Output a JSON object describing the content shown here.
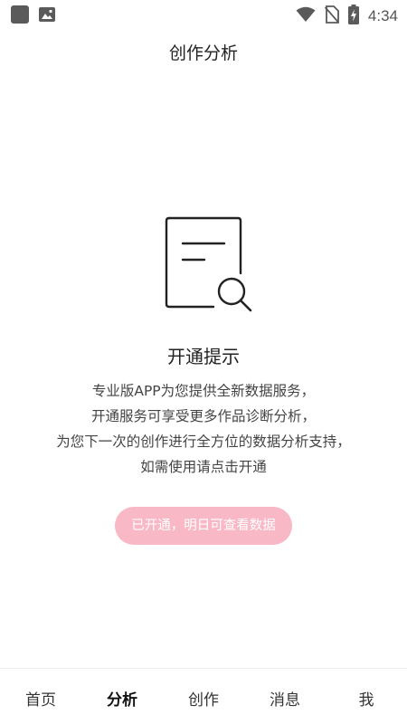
{
  "status_bar": {
    "time": "4:34",
    "left_icons": [
      "notification-square-icon",
      "image-icon"
    ],
    "right_icons": [
      "wifi-icon",
      "no-sim-icon",
      "battery-charging-icon"
    ]
  },
  "header": {
    "title": "创作分析"
  },
  "prompt": {
    "icon": "document-search-icon",
    "title": "开通提示",
    "description_lines": [
      "专业版APP为您提供全新数据服务，",
      "开通服务可享受更多作品诊断分析，",
      "为您下一次的创作进行全方位的数据分析支持，",
      "如需使用请点击开通"
    ],
    "button_label": "已开通，明日可查看数据"
  },
  "bottom_nav": {
    "items": [
      {
        "label": "首页",
        "active": false
      },
      {
        "label": "分析",
        "active": true
      },
      {
        "label": "创作",
        "active": false
      },
      {
        "label": "消息",
        "active": false
      },
      {
        "label": "我",
        "active": false
      }
    ]
  },
  "colors": {
    "button_bg": "#f9b8c6",
    "button_text": "#ffffff",
    "text_primary": "#222222",
    "text_secondary": "#444444"
  }
}
